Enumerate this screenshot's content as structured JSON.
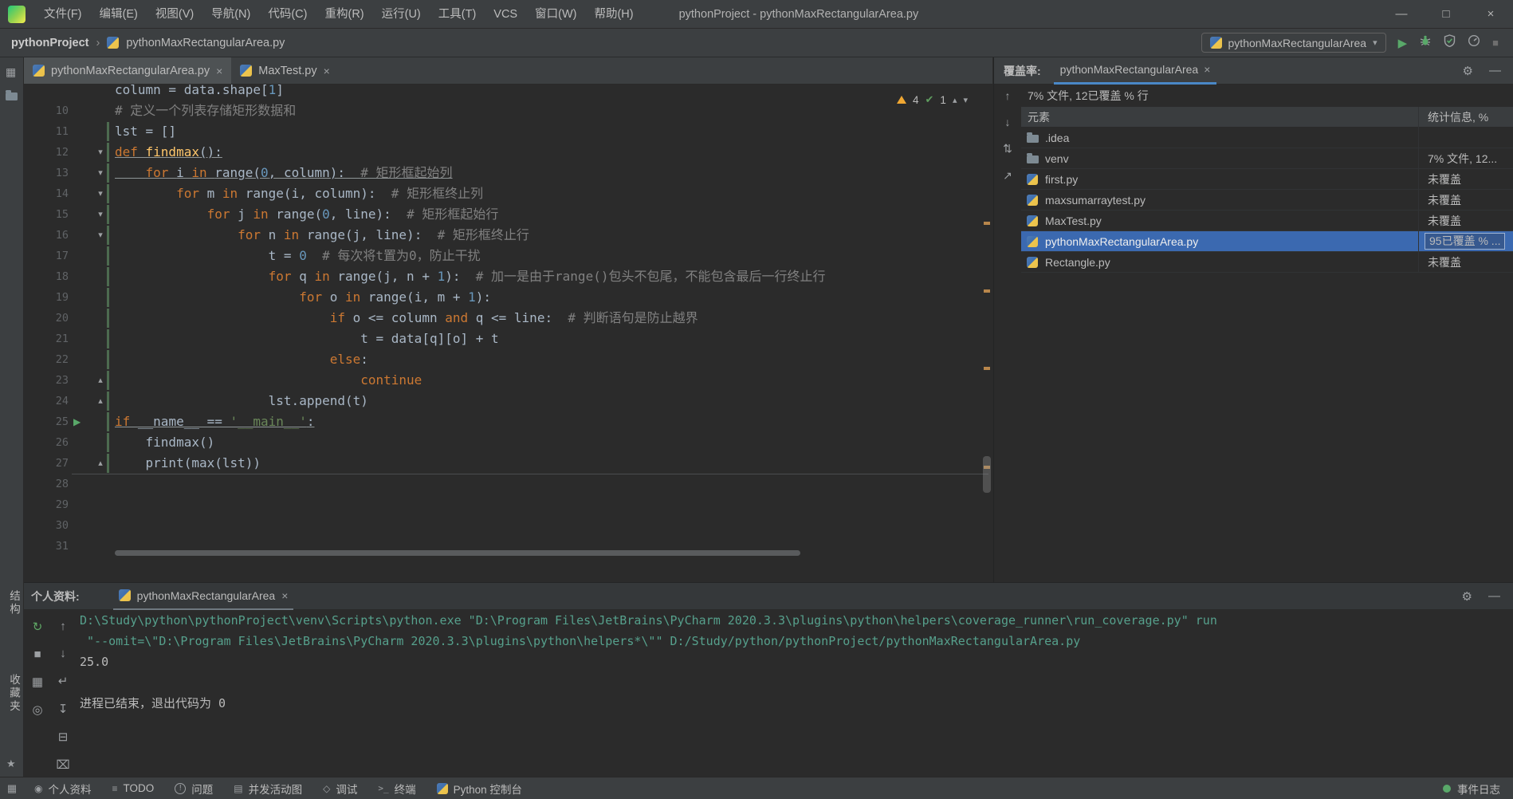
{
  "colors": {
    "accent": "#4a88c7",
    "selection": "#3b69b0",
    "run-green": "#59a869",
    "warning": "#f0a732",
    "keyword": "#cc7832",
    "number": "#6897bb",
    "string": "#6a8759",
    "comment": "#808080",
    "func-name": "#ffc66b",
    "code-fg": "#a9b7c6",
    "chrome-bg": "#3c3f41",
    "editor-bg": "#2b2b2b",
    "console-cmd": "#56a08c",
    "gutter-fg": "#606366",
    "coverage-green": "#4d6b50",
    "error-stripe-mark": "#b8864b"
  },
  "icons": {
    "close": "×",
    "gear": "⚙",
    "minimize_panel": "—",
    "chevron_up": "▴",
    "chevron_down": "▾",
    "check": "✔",
    "play": "▶",
    "stop": "■",
    "combo_arrow": "▾",
    "switcher": "▦",
    "terminal": ">_"
  },
  "menu_bar": {
    "items": [
      "文件(F)",
      "编辑(E)",
      "视图(V)",
      "导航(N)",
      "代码(C)",
      "重构(R)",
      "运行(U)",
      "工具(T)",
      "VCS",
      "窗口(W)",
      "帮助(H)"
    ],
    "window_title": "pythonProject - pythonMaxRectangularArea.py"
  },
  "window_controls": {
    "minimize": "—",
    "maximize": "□",
    "close": "×"
  },
  "breadcrumb": {
    "project": "pythonProject",
    "separator": "›",
    "file": "pythonMaxRectangularArea.py"
  },
  "run_widget": {
    "config_name": "pythonMaxRectangularArea"
  },
  "left_stripe": {
    "labels": [
      "结构",
      "收藏夹"
    ],
    "favorites_icon": "★"
  },
  "editor": {
    "tabs": [
      {
        "label": "pythonMaxRectangularArea.py",
        "active": true
      },
      {
        "label": "MaxTest.py",
        "active": false
      }
    ],
    "inspections": {
      "warnings": "4",
      "passed": "1"
    },
    "lines": [
      {
        "n": "",
        "tokens": [
          [
            "d",
            "column = data.shape["
          ],
          [
            "n",
            "1"
          ],
          [
            "d",
            "]"
          ]
        ]
      },
      {
        "n": "10",
        "tokens": [
          [
            "c",
            "# 定义一个列表存储矩形数据和"
          ]
        ]
      },
      {
        "n": "11",
        "cov": true,
        "tokens": [
          [
            "d",
            "lst = []"
          ]
        ]
      },
      {
        "n": "12",
        "cov": true,
        "ul": true,
        "fold": "down",
        "tokens": [
          [
            "k",
            "def "
          ],
          [
            "f",
            "findmax"
          ],
          [
            "d",
            "():"
          ]
        ]
      },
      {
        "n": "13",
        "cov": true,
        "ul": true,
        "fold": "down",
        "tokens": [
          [
            "d",
            "    "
          ],
          [
            "k",
            "for "
          ],
          [
            "d",
            "i "
          ],
          [
            "k",
            "in "
          ],
          [
            "d",
            "range("
          ],
          [
            "n",
            "0"
          ],
          [
            "d",
            ", column):  "
          ],
          [
            "c",
            "# 矩形框起始列"
          ]
        ]
      },
      {
        "n": "14",
        "cov": true,
        "fold": "down",
        "tokens": [
          [
            "d",
            "        "
          ],
          [
            "k",
            "for "
          ],
          [
            "d",
            "m "
          ],
          [
            "k",
            "in "
          ],
          [
            "d",
            "range(i, column):  "
          ],
          [
            "c",
            "# 矩形框终止列"
          ]
        ]
      },
      {
        "n": "15",
        "cov": true,
        "fold": "down",
        "tokens": [
          [
            "d",
            "            "
          ],
          [
            "k",
            "for "
          ],
          [
            "d",
            "j "
          ],
          [
            "k",
            "in "
          ],
          [
            "d",
            "range("
          ],
          [
            "n",
            "0"
          ],
          [
            "d",
            ", line):  "
          ],
          [
            "c",
            "# 矩形框起始行"
          ]
        ]
      },
      {
        "n": "16",
        "cov": true,
        "fold": "down",
        "tokens": [
          [
            "d",
            "                "
          ],
          [
            "k",
            "for "
          ],
          [
            "d",
            "n "
          ],
          [
            "k",
            "in "
          ],
          [
            "d",
            "range(j, line):  "
          ],
          [
            "c",
            "# 矩形框终止行"
          ]
        ]
      },
      {
        "n": "17",
        "cov": true,
        "tokens": [
          [
            "d",
            "                    t = "
          ],
          [
            "n",
            "0"
          ],
          [
            "d",
            "  "
          ],
          [
            "c",
            "# 每次将t置为0，防止干扰"
          ]
        ]
      },
      {
        "n": "18",
        "cov": true,
        "tokens": [
          [
            "d",
            "                    "
          ],
          [
            "k",
            "for "
          ],
          [
            "d",
            "q "
          ],
          [
            "k",
            "in "
          ],
          [
            "d",
            "range(j, n + "
          ],
          [
            "n",
            "1"
          ],
          [
            "d",
            "):  "
          ],
          [
            "c",
            "# 加一是由于range()包头不包尾，不能包含最后一行终止行"
          ]
        ]
      },
      {
        "n": "19",
        "cov": true,
        "tokens": [
          [
            "d",
            "                        "
          ],
          [
            "k",
            "for "
          ],
          [
            "d",
            "o "
          ],
          [
            "k",
            "in "
          ],
          [
            "d",
            "range(i, m + "
          ],
          [
            "n",
            "1"
          ],
          [
            "d",
            "):"
          ]
        ]
      },
      {
        "n": "20",
        "cov": true,
        "tokens": [
          [
            "d",
            "                            "
          ],
          [
            "k",
            "if "
          ],
          [
            "d",
            "o <= column "
          ],
          [
            "k",
            "and "
          ],
          [
            "d",
            "q <= line:  "
          ],
          [
            "c",
            "# 判断语句是防止越界"
          ]
        ]
      },
      {
        "n": "21",
        "cov": true,
        "tokens": [
          [
            "d",
            "                                t = data[q][o] + t"
          ]
        ]
      },
      {
        "n": "22",
        "cov": true,
        "tokens": [
          [
            "d",
            "                            "
          ],
          [
            "k",
            "else"
          ],
          [
            "d",
            ":"
          ]
        ]
      },
      {
        "n": "23",
        "cov": true,
        "fold": "up",
        "tokens": [
          [
            "d",
            "                                "
          ],
          [
            "k",
            "continue"
          ]
        ]
      },
      {
        "n": "24",
        "cov": true,
        "fold": "up",
        "tokens": [
          [
            "d",
            "                    lst.append(t)"
          ]
        ]
      },
      {
        "n": "25",
        "cov": true,
        "ul": true,
        "run": true,
        "tokens": [
          [
            "k",
            "if "
          ],
          [
            "d",
            "__name__ == "
          ],
          [
            "s",
            "'__main__'"
          ],
          [
            "d",
            ":"
          ]
        ]
      },
      {
        "n": "26",
        "cov": true,
        "tokens": [
          [
            "d",
            "    findmax()"
          ]
        ]
      },
      {
        "n": "27",
        "cov": true,
        "fold": "up",
        "tokens": [
          [
            "d",
            "    print(max(lst))"
          ]
        ]
      },
      {
        "n": "28",
        "tokens": []
      },
      {
        "n": "29",
        "tokens": []
      },
      {
        "n": "30",
        "tokens": []
      },
      {
        "n": "31",
        "tokens": []
      }
    ]
  },
  "coverage": {
    "panel_label": "覆盖率:",
    "tab": "pythonMaxRectangularArea",
    "summary": "7% 文件, 12已覆盖 % 行",
    "columns": {
      "element": "元素",
      "stats": "统计信息, %"
    },
    "toolbar_icons": [
      {
        "name": "prev-coverage-icon",
        "glyph": "↑"
      },
      {
        "name": "next-coverage-icon",
        "glyph": "↓"
      },
      {
        "name": "flatten-packages-icon",
        "glyph": "⇅"
      },
      {
        "name": "export-report-icon",
        "glyph": "↗"
      }
    ],
    "rows": [
      {
        "icon": "folder",
        "name": ".idea",
        "stat": ""
      },
      {
        "icon": "folder",
        "name": "venv",
        "stat": "7% 文件, 12..."
      },
      {
        "icon": "py",
        "name": "first.py",
        "stat": "未覆盖"
      },
      {
        "icon": "py",
        "name": "maxsumarraytest.py",
        "stat": "未覆盖"
      },
      {
        "icon": "py",
        "name": "MaxTest.py",
        "stat": "未覆盖"
      },
      {
        "icon": "py",
        "name": "pythonMaxRectangularArea.py",
        "stat": "95已覆盖 % ...",
        "selected": true
      },
      {
        "icon": "py",
        "name": "Rectangle.py",
        "stat": "未覆盖"
      }
    ]
  },
  "console": {
    "label": "个人资料:",
    "tab": "pythonMaxRectangularArea",
    "toolbar_col1": [
      {
        "name": "rerun-icon",
        "glyph": "↻",
        "accent": true
      },
      {
        "name": "stop-icon",
        "glyph": "■"
      },
      {
        "name": "restore-layout-icon",
        "glyph": "▦"
      },
      {
        "name": "pin-icon",
        "glyph": "◎"
      }
    ],
    "toolbar_col2": [
      {
        "name": "up-stack-trace-icon",
        "glyph": "↑"
      },
      {
        "name": "down-stack-trace-icon",
        "glyph": "↓"
      },
      {
        "name": "soft-wrap-icon",
        "glyph": "↵"
      },
      {
        "name": "scroll-to-end-icon",
        "glyph": "↧"
      },
      {
        "name": "print-icon",
        "glyph": "⊟"
      },
      {
        "name": "clear-all-icon",
        "glyph": "⌧"
      }
    ],
    "lines": [
      {
        "kind": "cmd",
        "text": "D:\\Study\\python\\pythonProject\\venv\\Scripts\\python.exe \"D:\\Program Files\\JetBrains\\PyCharm 2020.3.3\\plugins\\python\\helpers\\coverage_runner\\run_coverage.py\" run"
      },
      {
        "kind": "cmd",
        "text": " \"--omit=\\\"D:\\Program Files\\JetBrains\\PyCharm 2020.3.3\\plugins\\python\\helpers*\\\"\" D:/Study/python/pythonProject/pythonMaxRectangularArea.py"
      },
      {
        "kind": "out",
        "text": "25.0"
      },
      {
        "kind": "out",
        "text": ""
      },
      {
        "kind": "out",
        "text": "进程已结束，退出代码为 0"
      }
    ]
  },
  "status_bar": {
    "items": [
      {
        "label": "个人资料",
        "glyph": "◉"
      },
      {
        "label": "TODO",
        "glyph": "≡"
      },
      {
        "label": "问题",
        "style": "circle",
        "glyph": "!"
      },
      {
        "label": "并发活动图",
        "glyph": "▤"
      },
      {
        "label": "调试",
        "glyph": "◇"
      },
      {
        "label": "终端",
        "style": "mono",
        "glyph": ">_"
      },
      {
        "label": "Python 控制台",
        "style": "py"
      }
    ],
    "right": {
      "label": "事件日志"
    }
  }
}
